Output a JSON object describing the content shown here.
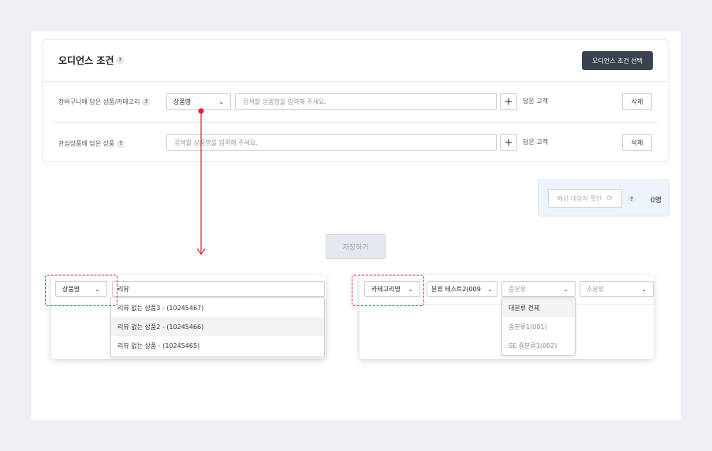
{
  "audience": {
    "title": "오디언스 조건",
    "select_button": "오디언스 조건 선택"
  },
  "rows": [
    {
      "label": "장바구니에 담은 상품/카테고리",
      "type_select": "상품명",
      "placeholder": "검색할 상품명을 입력해 주세요.",
      "suffix": "담은 고객",
      "delete_label": "삭제"
    },
    {
      "label": "관심상품에 담은 상품",
      "placeholder": "검색할 상품명을 입력해 주세요.",
      "suffix": "담은 고객",
      "delete_label": "삭제"
    }
  ],
  "estimate": {
    "button": "예상 대상자 확인",
    "count": "0명"
  },
  "save_button": "저장하기",
  "example_product": {
    "type_select": "상품명",
    "query": "리뷰",
    "results": [
      "리뷰 없는 상품3 - (10245467)",
      "리뷰 없는 상품2 - (10245466)",
      "리뷰 없는 상품 - (10245465)"
    ]
  },
  "example_category": {
    "type_select": "카테고리명",
    "large": "분류 테스트2(009",
    "medium_placeholder": "중분류",
    "small_placeholder": "소분류",
    "medium_options": [
      "대분류 전체",
      "중분류1(001)",
      "SE 중분류1(002)"
    ]
  },
  "colors": {
    "primary": "#3a4150",
    "annotation": "#e11d2a",
    "estimate_bg": "#eef4fb"
  }
}
